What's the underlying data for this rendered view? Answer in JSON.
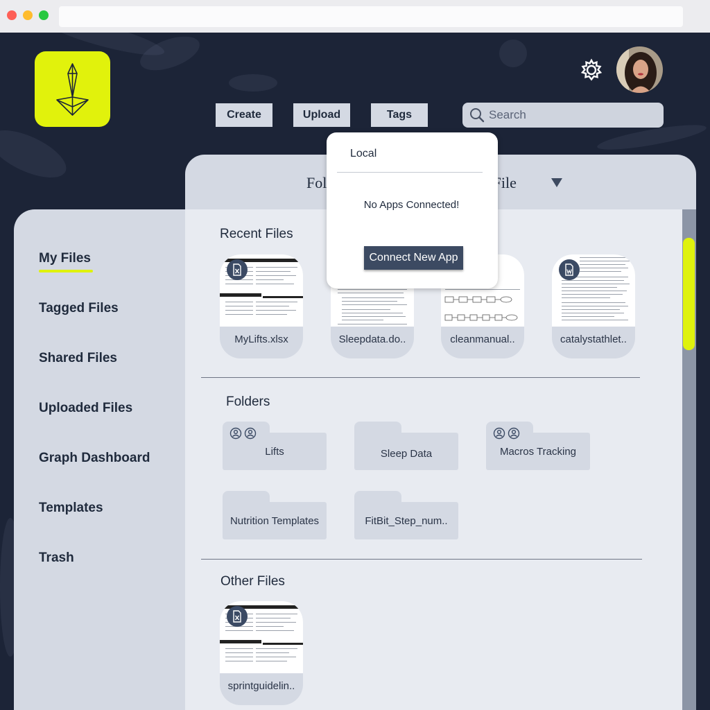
{
  "search": {
    "placeholder": "Search"
  },
  "toolbar": {
    "create_label": "Create",
    "upload_label": "Upload",
    "tags_label": "Tags"
  },
  "header": {
    "left_label_visible": "Fol",
    "right_label_visible": "nt File"
  },
  "upload_menu": {
    "local_label": "Local",
    "empty_message": "No Apps Connected!",
    "connect_label": "Connect New App"
  },
  "sidebar": {
    "items": [
      {
        "label": "My Files"
      },
      {
        "label": "Tagged Files"
      },
      {
        "label": "Shared Files"
      },
      {
        "label": "Uploaded Files"
      },
      {
        "label": "Graph Dashboard"
      },
      {
        "label": "Templates"
      },
      {
        "label": "Trash"
      }
    ]
  },
  "recent": {
    "title": "Recent Files",
    "files": [
      {
        "name": "MyLifts.xlsx",
        "icon": "excel-file-icon"
      },
      {
        "name": "Sleepdata.do..",
        "icon": "document-icon"
      },
      {
        "name": "cleanmanual..",
        "icon": "document-icon"
      },
      {
        "name": "catalystathlet..",
        "icon": "word-file-icon"
      }
    ]
  },
  "folders": {
    "title": "Folders",
    "items": [
      {
        "name": "Lifts",
        "shared": true
      },
      {
        "name": "Sleep Data",
        "shared": false
      },
      {
        "name": "Macros Tracking",
        "shared": true
      },
      {
        "name": "Nutrition Templates",
        "shared": false
      },
      {
        "name": "FitBit_Step_num..",
        "shared": false
      }
    ]
  },
  "other": {
    "title": "Other Files",
    "files": [
      {
        "name": "sprintguidelin..",
        "icon": "excel-file-icon"
      }
    ]
  },
  "colors": {
    "accent": "#e1f20c",
    "navy": "#1c2437",
    "panel": "#d4d9e3",
    "button_dark": "#3c4a62"
  }
}
